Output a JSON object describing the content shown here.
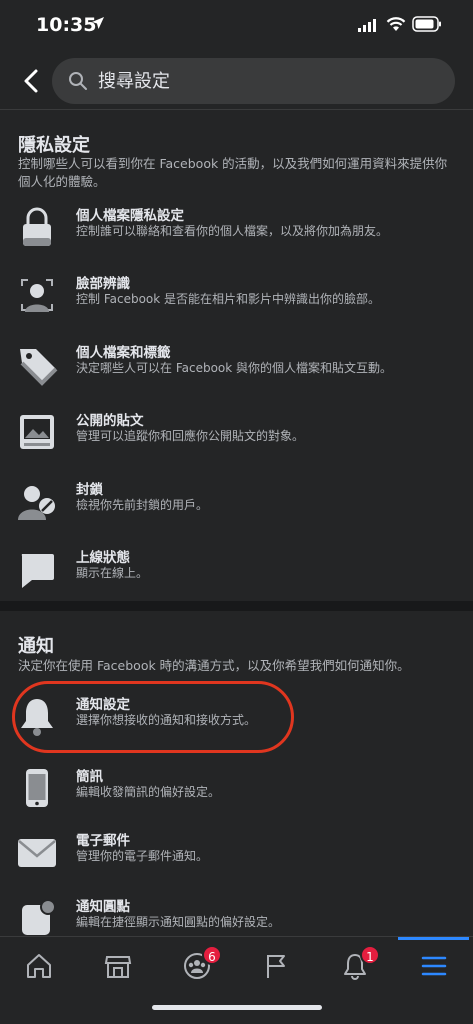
{
  "status_bar": {
    "time": "10:35"
  },
  "header": {
    "search_placeholder": "搜尋設定"
  },
  "privacy_section": {
    "title": "隱私設定",
    "description": "控制哪些人可以看到你在 Facebook 的活動，以及我們如何運用資料來提供你個人化的體驗。",
    "items": [
      {
        "title": "個人檔案隱私設定",
        "desc": "控制誰可以聯絡和查看你的個人檔案，以及將你加為朋友。",
        "icon": "lock-icon"
      },
      {
        "title": "臉部辨識",
        "desc": "控制 Facebook 是否能在相片和影片中辨識出你的臉部。",
        "icon": "face-recognition-icon"
      },
      {
        "title": "個人檔案和標籤",
        "desc": "決定哪些人可以在 Facebook 與你的個人檔案和貼文互動。",
        "icon": "tag-icon"
      },
      {
        "title": "公開的貼文",
        "desc": "管理可以追蹤你和回應你公開貼文的對象。",
        "icon": "public-post-icon"
      },
      {
        "title": "封鎖",
        "desc": "檢視你先前封鎖的用戶。",
        "icon": "block-user-icon"
      },
      {
        "title": "上線狀態",
        "desc": "顯示在線上。",
        "icon": "chat-bubble-icon"
      }
    ]
  },
  "notification_section": {
    "title": "通知",
    "description": "決定你在使用 Facebook 時的溝通方式，以及你希望我們如何通知你。",
    "items": [
      {
        "title": "通知設定",
        "desc": "選擇你想接收的通知和接收方式。",
        "icon": "bell-icon"
      },
      {
        "title": "簡訊",
        "desc": "編輯收發簡訊的偏好設定。",
        "icon": "phone-icon"
      },
      {
        "title": "電子郵件",
        "desc": "管理你的電子郵件通知。",
        "icon": "envelope-icon"
      },
      {
        "title": "通知圓點",
        "desc": "編輯在捷徑顯示通知圓點的偏好設定。",
        "icon": "notification-dot-icon"
      }
    ]
  },
  "tab_bar": {
    "groups_badge": "6",
    "notifications_badge": "1",
    "active_tab": "menu"
  },
  "colors": {
    "background": "#242526",
    "accent": "#2d88ff",
    "highlight_circle": "#e0361f",
    "badge": "#e41e3f"
  }
}
